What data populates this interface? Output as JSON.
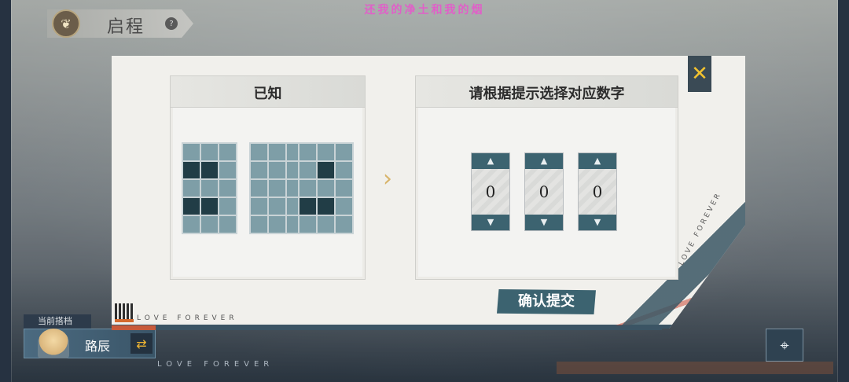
{
  "header": {
    "title": "启程",
    "help_icon": "question-icon",
    "subtitle": "还我的净土和我的烟"
  },
  "dialog": {
    "known_panel_title": "已知",
    "choose_panel_title": "请根据提示选择对应数字",
    "confirm_label": "确认提交",
    "close_icon": "close-icon",
    "watermark": "LOVE FOREVER",
    "side_watermark": "LOVE FOREVER",
    "known_grids": [
      {
        "rows": 5,
        "cols": 3,
        "dark_cells": [
          3,
          4,
          9,
          10
        ]
      },
      {
        "rows": 5,
        "cols": 3,
        "dark_cells": []
      },
      {
        "rows": 5,
        "cols": 3,
        "dark_cells": [
          4,
          9,
          10
        ]
      }
    ],
    "spinners": [
      {
        "value": "0"
      },
      {
        "value": "0"
      },
      {
        "value": "0"
      }
    ]
  },
  "partner": {
    "label": "当前搭档",
    "name": "路辰",
    "swap_icon": "swap-arrows-icon"
  },
  "footer": {
    "watermark": "LOVE FOREVER",
    "map_icon": "map-pin-icon"
  },
  "colors": {
    "accent_teal": "#3c6370",
    "dark_cell": "#213d46",
    "light_cell": "#7e9ea7",
    "close_gold": "#f2c230",
    "subtitle_pink": "#e060c8"
  }
}
